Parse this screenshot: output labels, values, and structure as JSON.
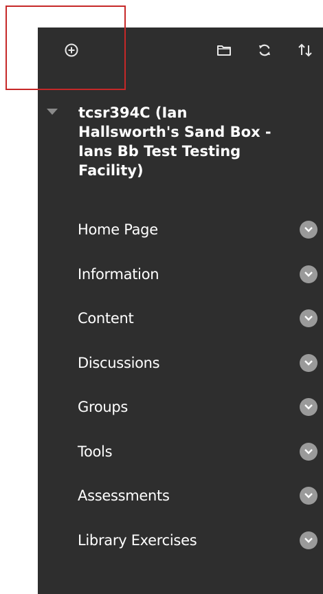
{
  "toolbar": {
    "add_icon": "add-circle-icon",
    "folder_icon": "folder-icon",
    "refresh_icon": "refresh-icon",
    "sort_icon": "sort-arrows-icon"
  },
  "course": {
    "title": "tcsr394C (Ian Hallsworth's Sand Box - Ians Bb Test Testing Facility)"
  },
  "menu": {
    "items": [
      {
        "label": "Home Page"
      },
      {
        "label": "Information"
      },
      {
        "label": "Content"
      },
      {
        "label": "Discussions"
      },
      {
        "label": "Groups"
      },
      {
        "label": "Tools"
      },
      {
        "label": "Assessments"
      },
      {
        "label": "Library Exercises"
      }
    ]
  },
  "colors": {
    "panel_bg": "#2e2e2e",
    "text": "#ffffff",
    "icon": "#e8e8e8",
    "chevron_bg": "#9a9a9a",
    "highlight_border": "#c62828"
  }
}
